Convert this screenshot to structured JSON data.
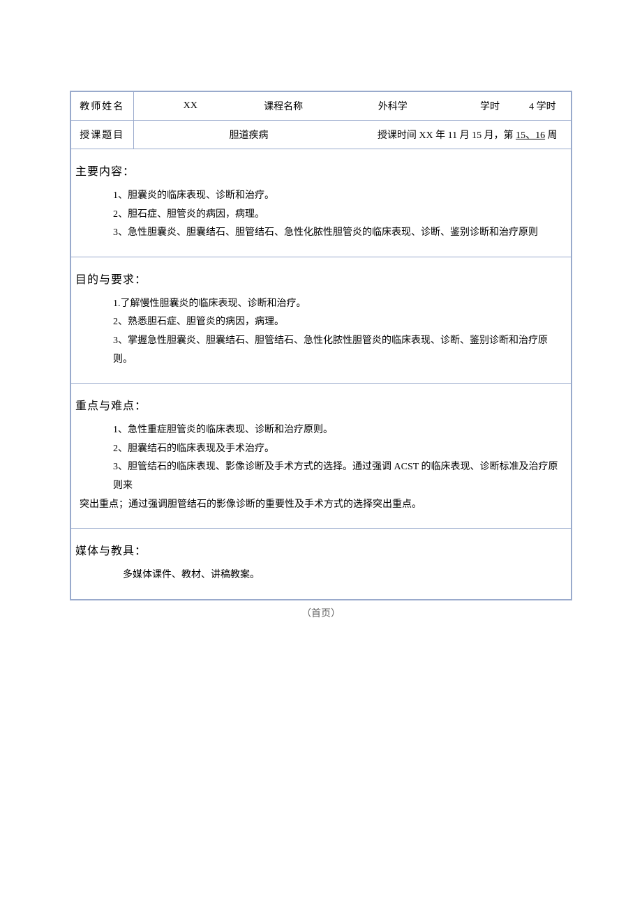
{
  "header": {
    "teacher_label": "教师姓名",
    "teacher_name": "XX",
    "course_label": "课程名称",
    "course_name": "外科学",
    "hours_label": "学时",
    "hours_value": "4 学时",
    "topic_label": "授课题目",
    "topic_value": "胆道疾病",
    "schedule_prefix": "授课时间 XX 年 11 月 15 月，第 ",
    "schedule_weeks": "15、16",
    "schedule_suffix": " 周"
  },
  "sections": {
    "main": {
      "title": "主要内容：",
      "items": [
        "1、胆囊炎的临床表现、诊断和治疗。",
        "2、胆石症、胆管炎的病因，病理。",
        "3、急性胆囊炎、胆囊结石、胆管结石、急性化脓性胆管炎的临床表现、诊断、鉴别诊断和治疗原则"
      ]
    },
    "purpose": {
      "title": "目的与要求：",
      "items": [
        "1.了解慢性胆囊炎的临床表现、诊断和治疗。",
        "2、熟悉胆石症、胆管炎的病因，病理。",
        "3、掌握急性胆囊炎、胆囊结石、胆管结石、急性化脓性胆管炎的临床表现、诊断、鉴别诊断和治疗原则。"
      ]
    },
    "key": {
      "title": "重点与难点：",
      "items": [
        "1、急性重症胆管炎的临床表现、诊断和治疗原则。",
        "2、胆囊结石的临床表现及手术治疗。",
        "3、胆管结石的临床表现、影像诊断及手术方式的选择。通过强调 ACST 的临床表现、诊断标准及治疗原则来"
      ],
      "continuation": "突出重点；通过强调胆管结石的影像诊断的重要性及手术方式的选择突出重点。"
    },
    "media": {
      "title": "媒体与教具：",
      "content": "多媒体课件、教材、讲稿教案。"
    }
  },
  "footer": "（首页）"
}
